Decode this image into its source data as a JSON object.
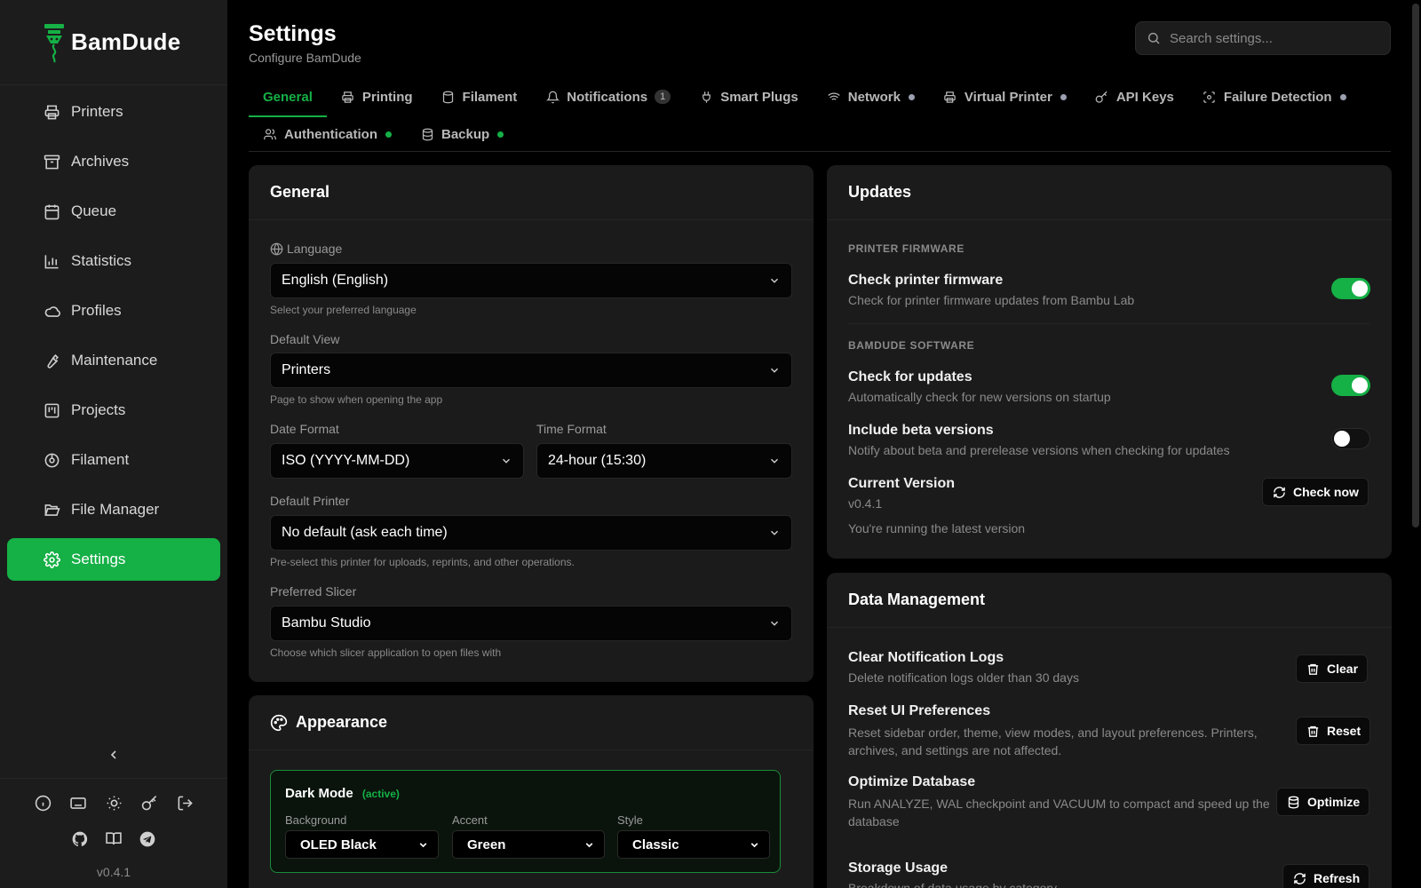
{
  "app": {
    "name": "BamDude",
    "version": "v0.4.1"
  },
  "colors": {
    "accent": "#15b046",
    "background": "#000000",
    "surface": "#1b1b1b"
  },
  "sidebar": {
    "items": [
      {
        "label": "Printers",
        "icon": "printer-icon"
      },
      {
        "label": "Archives",
        "icon": "archive-icon"
      },
      {
        "label": "Queue",
        "icon": "calendar-icon"
      },
      {
        "label": "Statistics",
        "icon": "bar-chart-icon"
      },
      {
        "label": "Profiles",
        "icon": "cloud-icon"
      },
      {
        "label": "Maintenance",
        "icon": "wrench-icon"
      },
      {
        "label": "Projects",
        "icon": "kanban-icon"
      },
      {
        "label": "Filament",
        "icon": "spool-icon"
      },
      {
        "label": "File Manager",
        "icon": "folder-open-icon"
      },
      {
        "label": "Settings",
        "icon": "gear-icon",
        "active": true
      }
    ],
    "collapse_icon": "chevron-left-icon",
    "footer_icons": [
      "info-icon",
      "keyboard-icon",
      "sun-icon",
      "key-icon",
      "logout-icon",
      "github-icon",
      "book-icon",
      "telegram-icon"
    ]
  },
  "header": {
    "title": "Settings",
    "subtitle": "Configure BamDude",
    "search_placeholder": "Search settings..."
  },
  "tabs": [
    {
      "label": "General",
      "active": true
    },
    {
      "label": "Printing",
      "icon": "printer-icon"
    },
    {
      "label": "Filament",
      "icon": "spool-icon"
    },
    {
      "label": "Notifications",
      "icon": "bell-icon",
      "badge": "1"
    },
    {
      "label": "Smart Plugs",
      "icon": "plug-icon"
    },
    {
      "label": "Network",
      "icon": "wifi-icon",
      "dot": "#9aa0b0"
    },
    {
      "label": "Virtual Printer",
      "icon": "printer-icon",
      "dot": "#9aa0b0"
    },
    {
      "label": "API Keys",
      "icon": "key-icon"
    },
    {
      "label": "Failure Detection",
      "icon": "scan-icon",
      "dot": "#9aa0b0"
    },
    {
      "label": "Authentication",
      "icon": "users-icon",
      "dot": "#15b046"
    },
    {
      "label": "Backup",
      "icon": "database-icon",
      "dot": "#15b046"
    }
  ],
  "general": {
    "title": "General",
    "language": {
      "label": "Language",
      "value": "English (English)",
      "hint": "Select your preferred language"
    },
    "default_view": {
      "label": "Default View",
      "value": "Printers",
      "hint": "Page to show when opening the app"
    },
    "date_format": {
      "label": "Date Format",
      "value": "ISO (YYYY-MM-DD)"
    },
    "time_format": {
      "label": "Time Format",
      "value": "24-hour (15:30)"
    },
    "default_printer": {
      "label": "Default Printer",
      "value": "No default (ask each time)",
      "hint": "Pre-select this printer for uploads, reprints, and other operations."
    },
    "preferred_slicer": {
      "label": "Preferred Slicer",
      "value": "Bambu Studio",
      "hint": "Choose which slicer application to open files with"
    }
  },
  "appearance": {
    "title": "Appearance",
    "dark_mode": {
      "title": "Dark Mode",
      "status": "(active)",
      "background_label": "Background",
      "background_value": "OLED Black",
      "accent_label": "Accent",
      "accent_value": "Green",
      "style_label": "Style",
      "style_value": "Classic"
    }
  },
  "updates": {
    "title": "Updates",
    "firmware_section": "PRINTER FIRMWARE",
    "check_firmware": {
      "title": "Check printer firmware",
      "desc": "Check for printer firmware updates from Bambu Lab",
      "on": true
    },
    "software_section": "BAMDUDE SOFTWARE",
    "check_updates": {
      "title": "Check for updates",
      "desc": "Automatically check for new versions on startup",
      "on": true
    },
    "include_beta": {
      "title": "Include beta versions",
      "desc": "Notify about beta and prerelease versions when checking for updates",
      "on": false
    },
    "current_version": {
      "title": "Current Version",
      "value": "v0.4.1",
      "status": "You're running the latest version",
      "button": "Check now"
    }
  },
  "data_management": {
    "title": "Data Management",
    "clear_logs": {
      "title": "Clear Notification Logs",
      "desc": "Delete notification logs older than 30 days",
      "button": "Clear"
    },
    "reset_ui": {
      "title": "Reset UI Preferences",
      "desc": "Reset sidebar order, theme, view modes, and layout preferences. Printers, archives, and settings are not affected.",
      "button": "Reset"
    },
    "optimize_db": {
      "title": "Optimize Database",
      "desc": "Run ANALYZE, WAL checkpoint and VACUUM to compact and speed up the database",
      "button": "Optimize"
    },
    "storage": {
      "title": "Storage Usage",
      "desc": "Breakdown of data usage by category",
      "button": "Refresh"
    }
  }
}
